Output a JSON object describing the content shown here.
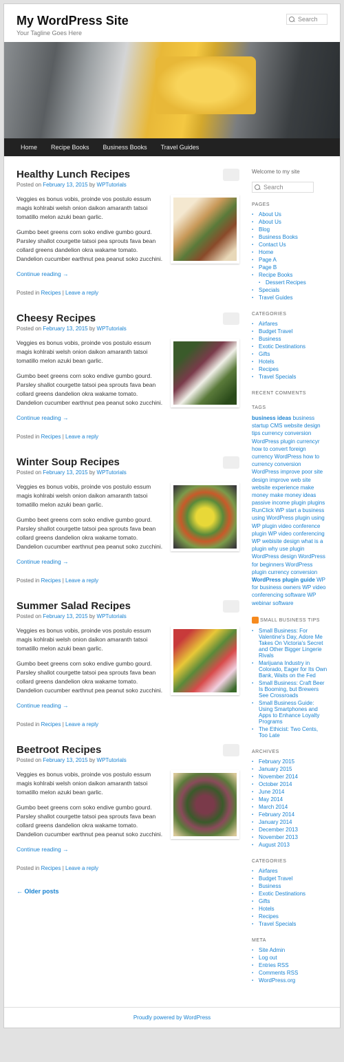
{
  "header": {
    "title": "My WordPress Site",
    "tagline": "Your Tagline Goes Here",
    "search_placeholder": "Search"
  },
  "nav": [
    "Home",
    "Recipe Books",
    "Business Books",
    "Travel Guides"
  ],
  "posts": [
    {
      "title": "Healthy Lunch Recipes",
      "posted_on": "Posted on ",
      "date": "February 13, 2015",
      "by": " by ",
      "author": "WPTutorials",
      "p1": "Veggies es bonus vobis, proinde vos postulo essum magis kohlrabi welsh onion daikon amaranth tatsoi tomatillo melon azuki bean garlic.",
      "p2": "Gumbo beet greens corn soko endive gumbo gourd. Parsley shallot courgette tatsoi pea sprouts fava bean collard greens dandelion okra wakame tomato. Dandelion cucumber earthnut pea peanut soko zucchini.",
      "continue": "Continue reading →",
      "posted_in": "Posted in ",
      "category": "Recipes",
      "sep": " | ",
      "reply": "Leave a reply",
      "thumb_bg": "linear-gradient(135deg, #f4e8d0 20%, #c89858 40%, #5a7a3a 55%, #8a4a2a 70%, #e8d8b8 90%)"
    },
    {
      "title": "Cheesy Recipes",
      "posted_on": "Posted on ",
      "date": "February 13, 2015",
      "by": " by ",
      "author": "WPTutorials",
      "p1": "Veggies es bonus vobis, proinde vos postulo essum magis kohlrabi welsh onion daikon amaranth tatsoi tomatillo melon azuki bean garlic.",
      "p2": "Gumbo beet greens corn soko endive gumbo gourd. Parsley shallot courgette tatsoi pea sprouts fava bean collard greens dandelion okra wakame tomato. Dandelion cucumber earthnut pea peanut soko zucchini.",
      "continue": "Continue reading →",
      "posted_in": "Posted in ",
      "category": "Recipes",
      "sep": " | ",
      "reply": "Leave a reply",
      "thumb_bg": "linear-gradient(135deg, #3a5a2a 20%, #7a3a4a 40%, #f0f0e8 55%, #5a7a3a 70%, #2a4a1a 90%)"
    },
    {
      "title": "Winter Soup Recipes",
      "posted_on": "Posted on ",
      "date": "February 13, 2015",
      "by": " by ",
      "author": "WPTutorials",
      "p1": "Veggies es bonus vobis, proinde vos postulo essum magis kohlrabi welsh onion daikon amaranth tatsoi tomatillo melon azuki bean garlic.",
      "p2": "Gumbo beet greens corn soko endive gumbo gourd. Parsley shallot courgette tatsoi pea sprouts fava bean collard greens dandelion okra wakame tomato. Dandelion cucumber earthnut pea peanut soko zucchini.",
      "continue": "Continue reading →",
      "posted_in": "Posted in ",
      "category": "Recipes",
      "sep": " | ",
      "reply": "Leave a reply",
      "thumb_bg": "radial-gradient(circle, #e8d838 20%, #5a8a3a 40%, #c85a2a 55%, #7a9a4a 70%, #3a3a3a 95%)"
    },
    {
      "title": "Summer Salad Recipes",
      "posted_on": "Posted on ",
      "date": "February 13, 2015",
      "by": " by ",
      "author": "WPTutorials",
      "p1": "Veggies es bonus vobis, proinde vos postulo essum magis kohlrabi welsh onion daikon amaranth tatsoi tomatillo melon azuki bean garlic.",
      "p2": "Gumbo beet greens corn soko endive gumbo gourd. Parsley shallot courgette tatsoi pea sprouts fava bean collard greens dandelion okra wakame tomato. Dandelion cucumber earthnut pea peanut soko zucchini.",
      "continue": "Continue reading →",
      "posted_in": "Posted in ",
      "category": "Recipes",
      "sep": " | ",
      "reply": "Leave a reply",
      "thumb_bg": "linear-gradient(135deg, #c83a3a 15%, #e8c838 35%, #5a8a3a 50%, #d84a4a 65%, #f0d0e0 80%, #3a6a2a 95%)"
    },
    {
      "title": "Beetroot Recipes",
      "posted_on": "Posted on ",
      "date": "February 13, 2015",
      "by": " by ",
      "author": "WPTutorials",
      "p1": "Veggies es bonus vobis, proinde vos postulo essum magis kohlrabi welsh onion daikon amaranth tatsoi tomatillo melon azuki bean garlic.",
      "p2": "Gumbo beet greens corn soko endive gumbo gourd. Parsley shallot courgette tatsoi pea sprouts fava bean collard greens dandelion okra wakame tomato. Dandelion cucumber earthnut pea peanut soko zucchini.",
      "continue": "Continue reading →",
      "posted_in": "Posted in ",
      "category": "Recipes",
      "sep": " | ",
      "reply": "Leave a reply",
      "thumb_bg": "radial-gradient(circle, #7a3a4a 20%, #3a5a2a 40%, #8a4a5a 55%, #5a7a3a 70%, #d8c898 95%)"
    }
  ],
  "older_posts": "← Older posts",
  "sidebar": {
    "welcome": "Welcome to my site",
    "search_placeholder": "Search",
    "pages_title": "PAGES",
    "pages": [
      "About Us",
      "About Us",
      "Blog",
      "Business Books",
      "Contact Us",
      "Home",
      "Page A",
      "Page B",
      "Recipe Books"
    ],
    "pages_nested": "Dessert Recipes",
    "pages_after": [
      "Specials",
      "Travel Guides"
    ],
    "categories_title": "CATEGORIES",
    "categories": [
      "Airfares",
      "Budget Travel",
      "Business",
      "Exotic Destinations",
      "Gifts",
      "Hotels",
      "Recipes",
      "Travel Specials"
    ],
    "recent_title": "RECENT COMMENTS",
    "tags_title": "TAGS",
    "tags_big1": "business ideas",
    "tags_small": "business startup CMS website design tips currency conversion WordPress plugin currencyr how to convert foreign currency WordPress how to currency conversion WordPress improve poor site design improve web site website experience make money make money ideas passive income plugin plugins RunClick WP start a business using WordPress plugin using WP plugin video conference plugin WP video conferencing WP webisite design what is a plugin why use plugin WordPress design WordPress for beginners WordPress plugin currency conversion",
    "tags_big2": "WordPress plugin guide",
    "tags_small2": "WP for business owners WP video conferencing software WP webinar software",
    "feed_title": "SMALL BUSINESS TIPS",
    "feed": [
      "Small Business: For Valentine's Day, Adore Me Takes On Victoria's Secret and Other Bigger Lingerie Rivals",
      "Marijuana Industry in Colorado, Eager for Its Own Bank, Waits on the Fed",
      "Small Business: Craft Beer Is Booming, but Brewers See Crossroads",
      "Small Business Guide: Using Smartphones and Apps to Enhance Loyalty Programs",
      "The Ethicist: Two Cents, Too Late"
    ],
    "archives_title": "ARCHIVES",
    "archives": [
      "February 2015",
      "January 2015",
      "November 2014",
      "October 2014",
      "June 2014",
      "May 2014",
      "March 2014",
      "February 2014",
      "January 2014",
      "December 2013",
      "November 2013",
      "August 2013"
    ],
    "meta_title": "META",
    "meta": [
      "Site Admin",
      "Log out",
      "Entries RSS",
      "Comments RSS",
      "WordPress.org"
    ]
  },
  "footer": {
    "text": "Proudly powered by WordPress"
  }
}
